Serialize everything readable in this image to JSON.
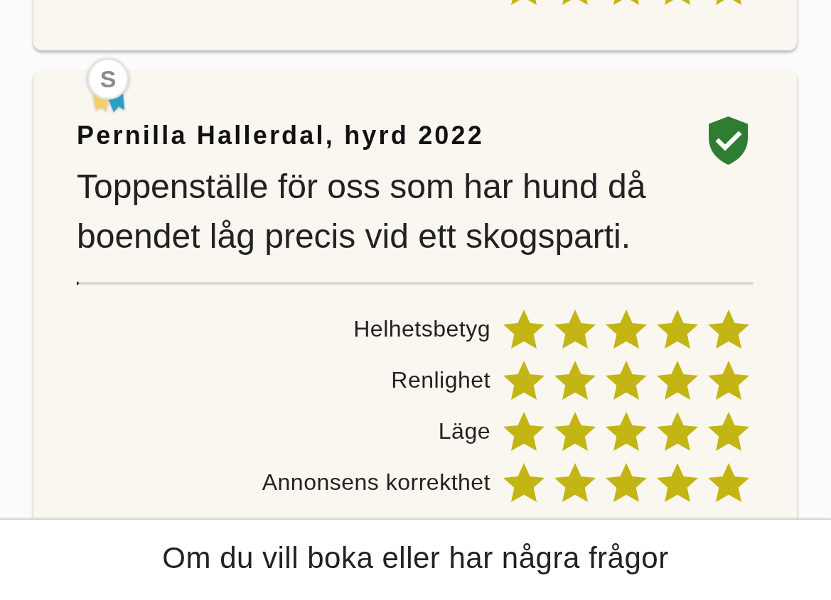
{
  "reviews": [
    {
      "ratings": [
        {
          "stars": 5
        }
      ]
    },
    {
      "badge": "S",
      "author": "Pernilla Hallerdal, hyrd 2022",
      "verified": true,
      "text": "Toppenställe för oss som har hund då boendet låg precis vid ett skogsparti.",
      "ratings": [
        {
          "label": "Helhetsbetyg",
          "stars": 5
        },
        {
          "label": "Renlighet",
          "stars": 5
        },
        {
          "label": "Läge",
          "stars": 5
        },
        {
          "label": "Annonsens korrekthet",
          "stars": 5
        }
      ]
    }
  ],
  "footer": {
    "text": "Om du vill boka eller har några frågor"
  }
}
